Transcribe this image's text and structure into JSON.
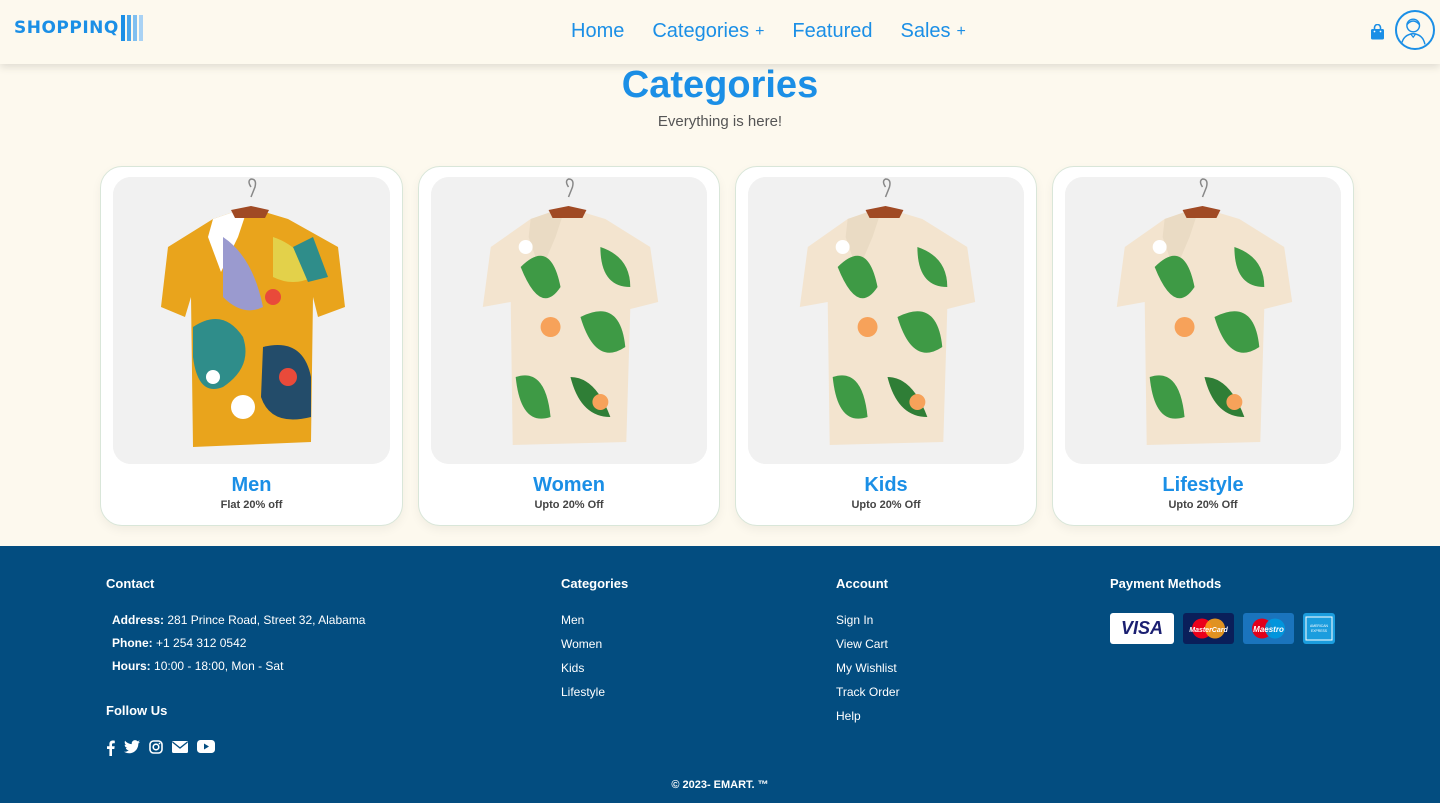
{
  "nav": {
    "logo_text": "SHOPPINQ",
    "links": [
      {
        "label": "Home",
        "has_plus": false
      },
      {
        "label": "Categories",
        "has_plus": true
      },
      {
        "label": "Featured",
        "has_plus": false
      },
      {
        "label": "Sales",
        "has_plus": true
      }
    ],
    "plus_symbol": "+",
    "icons": {
      "cart": "shopping-bag-icon",
      "user": "user-avatar-icon"
    }
  },
  "header": {
    "title": "Categories",
    "subtitle": "Everything is here!"
  },
  "categories": [
    {
      "name": "Men",
      "offer": "Flat 20% off",
      "image": "colorful-abstract-shirt"
    },
    {
      "name": "Women",
      "offer": "Upto 20% Off",
      "image": "floral-leaf-shirt"
    },
    {
      "name": "Kids",
      "offer": "Upto 20% Off",
      "image": "floral-leaf-shirt"
    },
    {
      "name": "Lifestyle",
      "offer": "Upto 20% Off",
      "image": "floral-leaf-shirt"
    }
  ],
  "footer": {
    "contact": {
      "heading": "Contact",
      "address_label": "Address:",
      "address": "281 Prince Road, Street 32, Alabama",
      "phone_label": "Phone:",
      "phone": "+1 254 312 0542",
      "hours_label": "Hours:",
      "hours": "10:00 - 18:00, Mon - Sat"
    },
    "follow": {
      "heading": "Follow Us",
      "icons": [
        "facebook-icon",
        "twitter-icon",
        "instagram-icon",
        "email-icon",
        "youtube-icon"
      ]
    },
    "categories": {
      "heading": "Categories",
      "links": [
        "Men",
        "Women",
        "Kids",
        "Lifestyle"
      ]
    },
    "account": {
      "heading": "Account",
      "links": [
        "Sign In",
        "View Cart",
        "My Wishlist",
        "Track Order",
        "Help"
      ]
    },
    "payment": {
      "heading": "Payment Methods",
      "methods": [
        "VISA",
        "MasterCard",
        "Maestro",
        "American Express"
      ]
    },
    "copyright": "© 2023- EMART. ™"
  },
  "colors": {
    "accent": "#1b8fe6",
    "page_bg": "#fdf9ee",
    "footer_bg": "#034d80"
  }
}
